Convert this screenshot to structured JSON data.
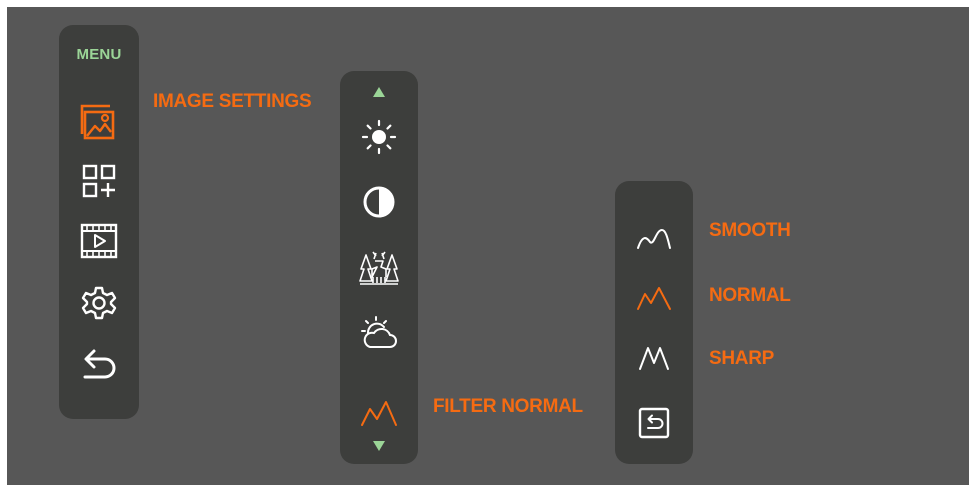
{
  "colors": {
    "background": "#575757",
    "panel": "#3d3e3c",
    "accent_orange": "#f56b12",
    "accent_green": "#9bd597",
    "icon_white": "#ffffff"
  },
  "main_menu": {
    "title": "MENU",
    "items": [
      {
        "icon": "image-icon",
        "active": true
      },
      {
        "icon": "add-widget-icon",
        "active": false
      },
      {
        "icon": "video-film-icon",
        "active": false
      },
      {
        "icon": "gear-icon",
        "active": false
      },
      {
        "icon": "back-arrow-icon",
        "active": false
      }
    ]
  },
  "image_settings": {
    "label": "IMAGE SETTINGS",
    "items": [
      {
        "icon": "brightness-icon"
      },
      {
        "icon": "contrast-icon"
      },
      {
        "icon": "deer-forest-icon"
      },
      {
        "icon": "sun-cloud-icon"
      },
      {
        "icon": "filter-normal-icon",
        "active": true
      }
    ],
    "scroll_up_icon": "triangle-up-icon",
    "scroll_down_icon": "triangle-down-icon",
    "active_label": "FILTER NORMAL"
  },
  "filter_menu": {
    "items": [
      {
        "label": "SMOOTH",
        "icon": "filter-smooth-icon"
      },
      {
        "label": "NORMAL",
        "icon": "filter-normal-icon",
        "active": true
      },
      {
        "label": "SHARP",
        "icon": "filter-sharp-icon"
      }
    ],
    "back_icon": "return-box-icon"
  }
}
